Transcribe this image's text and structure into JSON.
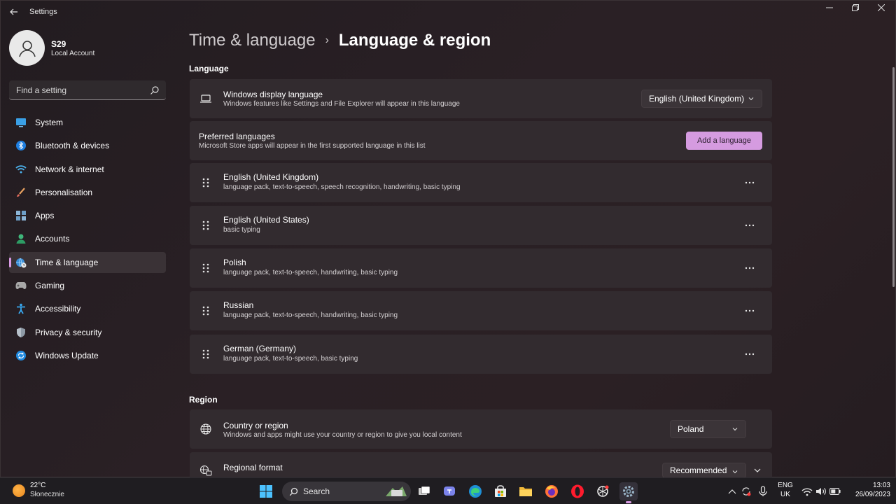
{
  "window": {
    "title": "Settings",
    "controls": {
      "minimize": "—",
      "maximize": "▢",
      "close": "✕"
    }
  },
  "user": {
    "name": "S29",
    "account_type": "Local Account"
  },
  "search": {
    "placeholder": "Find a setting"
  },
  "nav": {
    "active": "Time & language",
    "items": [
      {
        "label": "System",
        "icon": "monitor-icon"
      },
      {
        "label": "Bluetooth & devices",
        "icon": "bluetooth-icon"
      },
      {
        "label": "Network & internet",
        "icon": "wifi-icon"
      },
      {
        "label": "Personalisation",
        "icon": "brush-icon"
      },
      {
        "label": "Apps",
        "icon": "apps-icon"
      },
      {
        "label": "Accounts",
        "icon": "person-icon"
      },
      {
        "label": "Time & language",
        "icon": "globe-clock-icon"
      },
      {
        "label": "Gaming",
        "icon": "gamepad-icon"
      },
      {
        "label": "Accessibility",
        "icon": "accessibility-icon"
      },
      {
        "label": "Privacy & security",
        "icon": "shield-icon"
      },
      {
        "label": "Windows Update",
        "icon": "update-icon"
      }
    ]
  },
  "breadcrumb": {
    "parent": "Time & language",
    "separator": "›",
    "current": "Language & region"
  },
  "language_section": {
    "title": "Language",
    "display_language": {
      "title": "Windows display language",
      "subtitle": "Windows features like Settings and File Explorer will appear in this language",
      "value": "English (United Kingdom)"
    },
    "preferred": {
      "title": "Preferred languages",
      "subtitle": "Microsoft Store apps will appear in the first supported language in this list",
      "add_button": "Add a language"
    },
    "languages": [
      {
        "name": "English (United Kingdom)",
        "features": "language pack, text-to-speech, speech recognition, handwriting, basic typing"
      },
      {
        "name": "English (United States)",
        "features": "basic typing"
      },
      {
        "name": "Polish",
        "features": "language pack, text-to-speech, handwriting, basic typing"
      },
      {
        "name": "Russian",
        "features": "language pack, text-to-speech, handwriting, basic typing"
      },
      {
        "name": "German (Germany)",
        "features": "language pack, text-to-speech, basic typing"
      }
    ],
    "more_label": "···"
  },
  "region_section": {
    "title": "Region",
    "country": {
      "title": "Country or region",
      "subtitle": "Windows and apps might use your country or region to give you local content",
      "value": "Poland"
    },
    "format": {
      "title": "Regional format",
      "value": "Recommended"
    }
  },
  "taskbar": {
    "weather": {
      "temp": "22°C",
      "desc": "Słonecznie"
    },
    "search_label": "Search",
    "language": {
      "line1": "ENG",
      "line2": "UK"
    },
    "time": "13:03",
    "date": "26/09/2023"
  },
  "colors": {
    "accent": "#d99be4",
    "button": "#d59be0",
    "card": "#322b2f",
    "taskbar": "#1f1d21"
  }
}
